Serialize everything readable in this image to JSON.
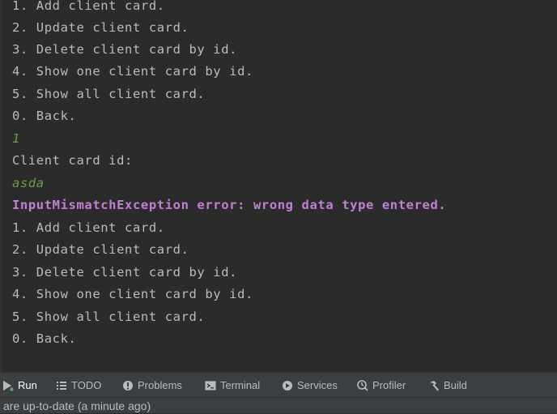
{
  "console": {
    "lines": [
      {
        "text": "1. Add client card.",
        "kind": "output"
      },
      {
        "text": "2. Update client card.",
        "kind": "output"
      },
      {
        "text": "3. Delete client card by id.",
        "kind": "output"
      },
      {
        "text": "4. Show one client card by id.",
        "kind": "output"
      },
      {
        "text": "5. Show all client card.",
        "kind": "output"
      },
      {
        "text": "0. Back.",
        "kind": "output"
      },
      {
        "text": "1",
        "kind": "input"
      },
      {
        "text": "Client card id:",
        "kind": "output"
      },
      {
        "text": "asda",
        "kind": "input"
      },
      {
        "text": "InputMismatchException error: wrong data type entered.",
        "kind": "error"
      },
      {
        "text": "1. Add client card.",
        "kind": "output"
      },
      {
        "text": "2. Update client card.",
        "kind": "output"
      },
      {
        "text": "3. Delete client card by id.",
        "kind": "output"
      },
      {
        "text": "4. Show one client card by id.",
        "kind": "output"
      },
      {
        "text": "5. Show all client card.",
        "kind": "output"
      },
      {
        "text": "0. Back.",
        "kind": "output"
      }
    ]
  },
  "toolbar": {
    "tabs": [
      {
        "label": "Run",
        "icon": "run-icon",
        "active": true
      },
      {
        "label": "TODO",
        "icon": "todo-list-icon",
        "active": false
      },
      {
        "label": "Problems",
        "icon": "problems-icon",
        "active": false
      },
      {
        "label": "Terminal",
        "icon": "terminal-icon",
        "active": false
      },
      {
        "label": "Services",
        "icon": "services-icon",
        "active": false
      },
      {
        "label": "Profiler",
        "icon": "profiler-icon",
        "active": false
      },
      {
        "label": "Build",
        "icon": "build-hammer-icon",
        "active": false
      }
    ]
  },
  "status": {
    "message": "are up-to-date (a minute ago)"
  },
  "colors": {
    "background": "#2b2b2b",
    "output_text": "#bbbbbb",
    "input_text": "#6a9e47",
    "error_text": "#c27fd6",
    "toolbar_bg": "#3c3f41"
  }
}
